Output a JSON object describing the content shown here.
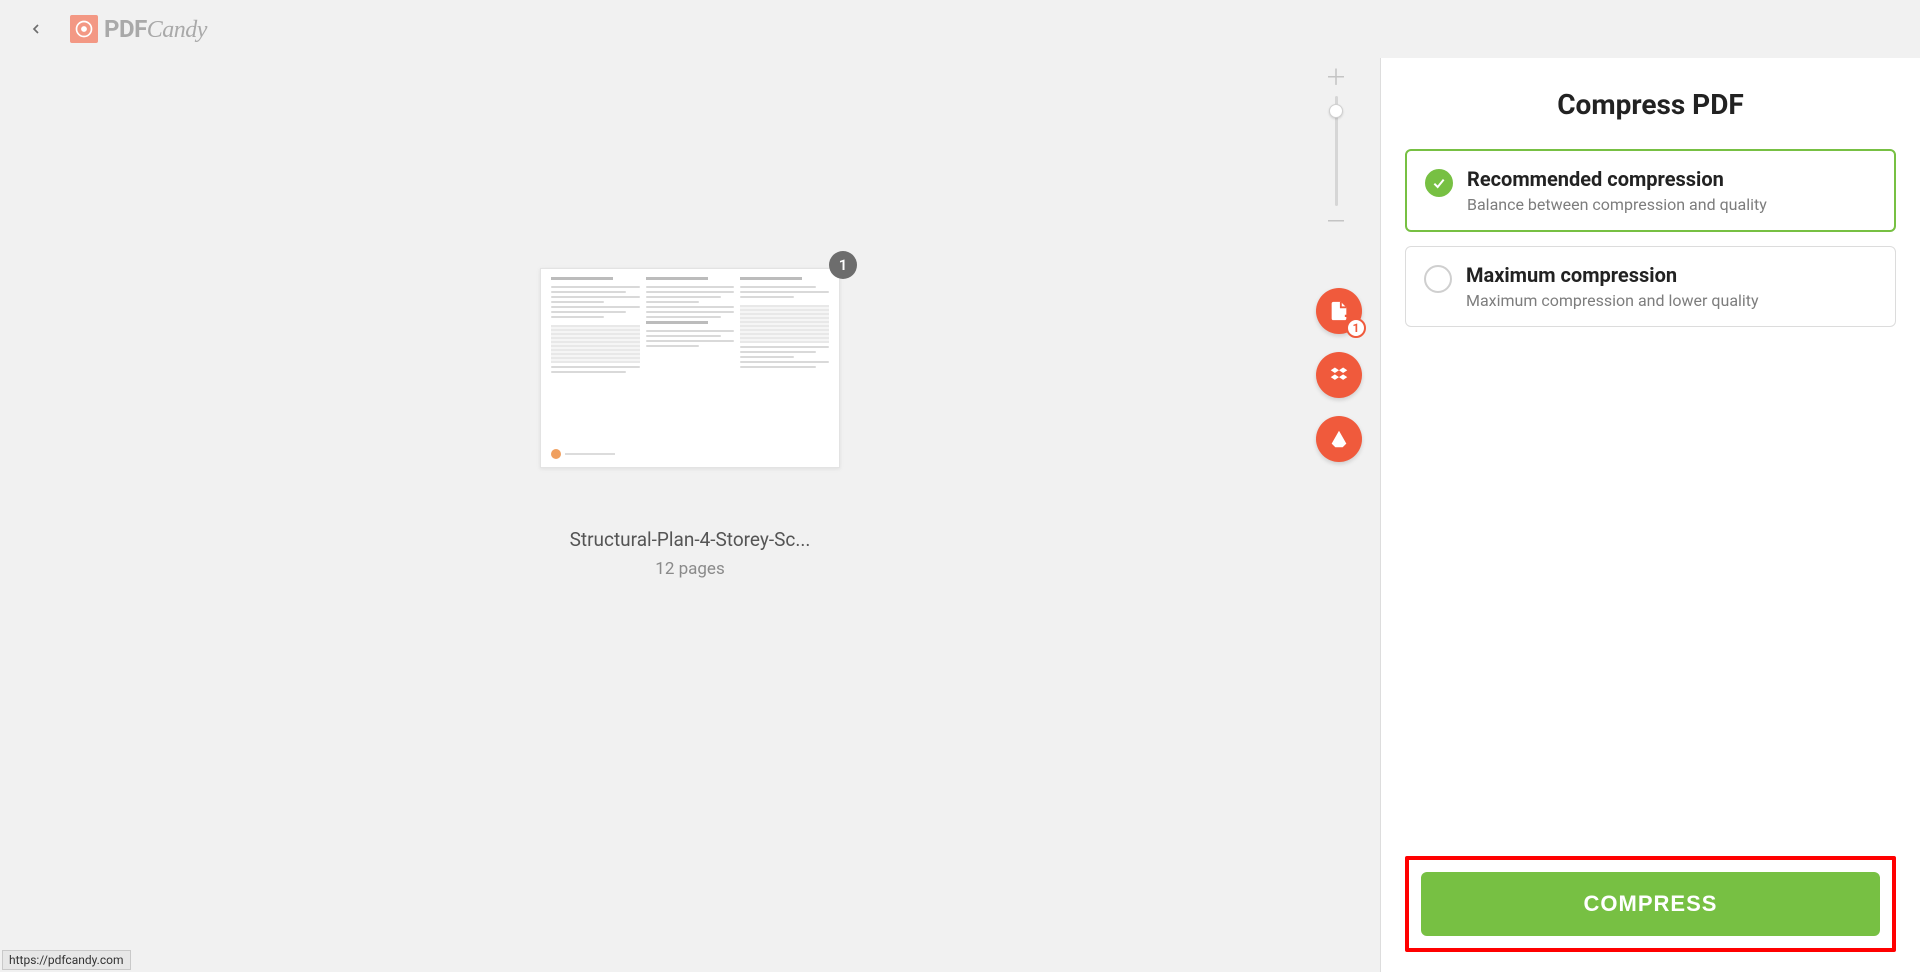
{
  "brand": {
    "name_strong": "PDF",
    "name_italic": "Candy"
  },
  "document": {
    "index_badge": "1",
    "title": "Structural-Plan-4-Storey-Sc...",
    "pages_label": "12 pages"
  },
  "add_file_count": "1",
  "sidebar": {
    "title": "Compress PDF",
    "options": [
      {
        "title": "Recommended compression",
        "subtitle": "Balance between compression and quality",
        "selected": true
      },
      {
        "title": "Maximum compression",
        "subtitle": "Maximum compression and lower quality",
        "selected": false
      }
    ],
    "action_label": "COMPRESS"
  },
  "status_url": "https://pdfcandy.com",
  "colors": {
    "accent_orange": "#f05a3c",
    "accent_green": "#77c043",
    "highlight_red": "#ff0000"
  }
}
